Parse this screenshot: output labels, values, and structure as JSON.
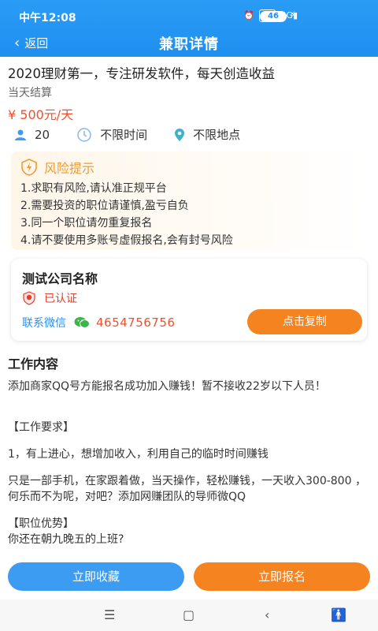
{
  "status_bar": {
    "time": "中午12:08",
    "signal": "4G",
    "hd": "HD",
    "battery": "46"
  },
  "nav": {
    "back_label": "返回",
    "title": "兼职详情"
  },
  "job": {
    "title": "2020理财第一，专注研发软件，每天创造收益",
    "settlement": "当天结算",
    "salary": "¥ 500元/天",
    "headcount": "20",
    "time": "不限时间",
    "location": "不限地点"
  },
  "risk": {
    "title": "风险提示",
    "items": [
      "1.求职有风险,请认准正规平台",
      "2.需要投资的职位请谨慎,盈亏自负",
      "3.同一个职位请勿重复报名",
      "4.请不要使用多账号虚假报名,会有封号风险"
    ]
  },
  "company": {
    "name": "测试公司名称",
    "verified": "已认证",
    "contact_label": "联系微信",
    "wechat_id": "4654756756",
    "copy_label": "点击复制"
  },
  "work": {
    "title": "工作内容",
    "lines": [
      "添加商家QQ号方能报名成功加入赚钱！暂不接收22岁以下人员！",
      "【工作要求】",
      "1，有上进心，想增加收入，利用自己的临时时间赚钱",
      "只是一部手机，在家跟着做，当天操作，轻松赚钱，一天收入300-800 ，何乐而不为呢，对吧？添加网赚团队的导师微QQ",
      "【职位优势】",
      "你还在朝九晚五的上班?"
    ]
  },
  "actions": {
    "collect": "立即收藏",
    "apply": "立即报名"
  },
  "colors": {
    "primary": "#1f8ff0",
    "accent": "#f5831f",
    "salary": "#f0502c",
    "warning": "#f39a2c"
  }
}
